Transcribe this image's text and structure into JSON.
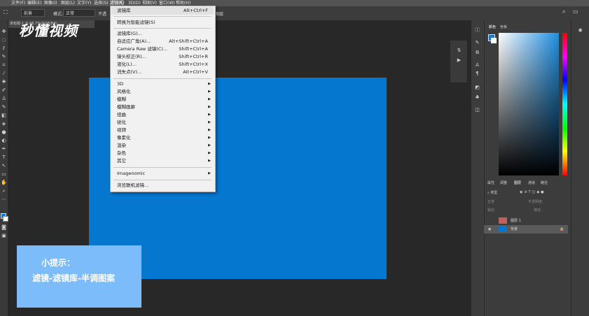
{
  "menubar": {
    "items": [
      "文件(F)",
      "编辑(E)",
      "图像(I)",
      "图层(L)",
      "文字(Y)",
      "选择(S)",
      "滤镜(T)",
      "3D(D)",
      "视图(V)",
      "窗口(W)",
      "帮助(H)"
    ]
  },
  "options": {
    "preset": "前景",
    "mode_label": "模式:",
    "mode_value": "正常",
    "opacity_label": "不透",
    "end_label": "图层"
  },
  "document": {
    "tab": "未标题-1 @ 66.7%(RGB/8#)"
  },
  "watermark": {
    "text": "秒懂视频"
  },
  "hint": {
    "title": "小提示：",
    "body": "滤镜-滤镜库-半调图案",
    "color": "#7dbcfa"
  },
  "canvas": {
    "color": "#0677cf"
  },
  "filter_menu": {
    "last_filter": {
      "label": "滤镜库",
      "shortcut": "Alt+Ctrl+F"
    },
    "convert": "转换为智能滤镜(S)",
    "group1": [
      {
        "label": "滤镜库(G)...",
        "shortcut": ""
      },
      {
        "label": "自适应广角(A)...",
        "shortcut": "Alt+Shift+Ctrl+A"
      },
      {
        "label": "Camera Raw 滤镜(C)...",
        "shortcut": "Shift+Ctrl+A"
      },
      {
        "label": "镜头校正(R)...",
        "shortcut": "Shift+Ctrl+R"
      },
      {
        "label": "液化(L)...",
        "shortcut": "Shift+Ctrl+X"
      },
      {
        "label": "消失点(V)...",
        "shortcut": "Alt+Ctrl+V"
      }
    ],
    "submenus": [
      "3D",
      "风格化",
      "模糊",
      "模糊画廊",
      "扭曲",
      "锐化",
      "视频",
      "像素化",
      "渲染",
      "杂色",
      "其它"
    ],
    "imagenomic": "Imagenomic",
    "browse": "浏览联机滤镜..."
  },
  "panels": {
    "color_tabs": [
      "颜色",
      "色板"
    ],
    "layer_tabs": [
      "属性",
      "调整",
      "图层",
      "通道",
      "路径"
    ],
    "kind": "类型",
    "blend": "正常",
    "opacity": "不透明度:",
    "lock": "锁定:",
    "fill": "填充:",
    "layers": [
      {
        "name": "图层 1"
      },
      {
        "name": "背景"
      }
    ]
  },
  "icons": {
    "menu_icon": "mouse-cursor-icon",
    "eye": "eye-icon",
    "lock": "lock-icon"
  }
}
